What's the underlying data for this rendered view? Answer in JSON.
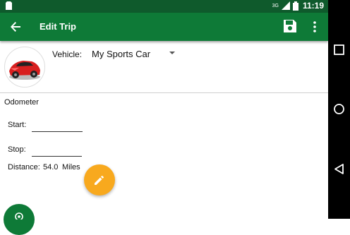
{
  "status_bar": {
    "time": "11:19",
    "network": "3G"
  },
  "app_bar": {
    "title": "Edit Trip"
  },
  "vehicle": {
    "label": "Vehicle:",
    "selected": "My Sports Car"
  },
  "odometer": {
    "section_title": "Odometer",
    "start_label": "Start:",
    "start_value": "",
    "stop_label": "Stop:",
    "stop_value": "",
    "distance_label": "Distance:",
    "distance_value": "54.0",
    "distance_unit": "Miles"
  },
  "colors": {
    "primary": "#0e7a37",
    "status_bar": "#0f5a2c",
    "accent": "#f8a91e"
  }
}
